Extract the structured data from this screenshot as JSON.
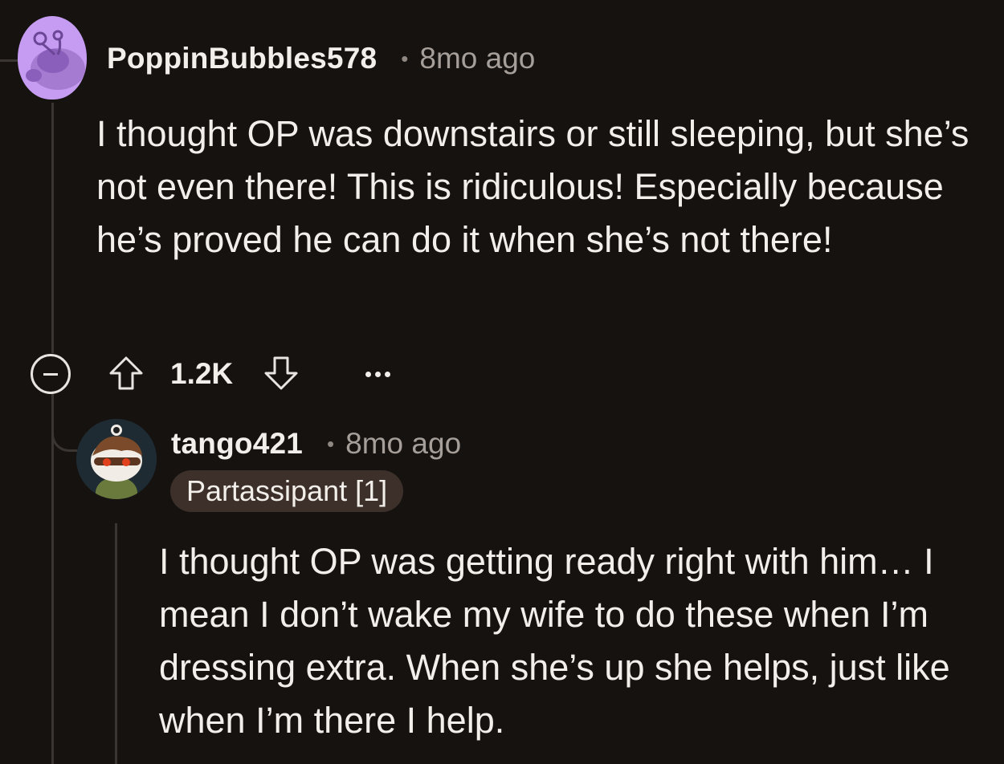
{
  "comment": {
    "username": "PoppinBubbles578",
    "separator": "•",
    "timestamp": "8mo ago",
    "body": "I thought OP was downstairs or still sleeping, but she’s not even there! This is ridiculous! Especially because he’s proved he can do it when she’s not there!",
    "actions": {
      "score": "1.2K",
      "collapse_icon": "collapse-minus-icon",
      "upvote_icon": "upvote-arrow-icon",
      "downvote_icon": "downvote-arrow-icon",
      "more_icon": "more-options-icon"
    },
    "avatar_icon": "snoo-avatar-icon",
    "avatar_color": "#c59cf2"
  },
  "reply": {
    "username": "tango421",
    "separator": "•",
    "timestamp": "8mo ago",
    "flair": "Partassipant [1]",
    "body": "I thought OP was getting ready right with him… I mean I don’t wake my wife to do these when I’m dressing extra. When she’s up she helps, just like when I’m there I help.",
    "avatar_icon": "snoo-avatar-icon"
  },
  "colors": {
    "background": "#151210",
    "text": "#f2eeea",
    "muted": "#a59e99",
    "flair_bg": "#3d302a",
    "thread_line": "#3a3532"
  }
}
